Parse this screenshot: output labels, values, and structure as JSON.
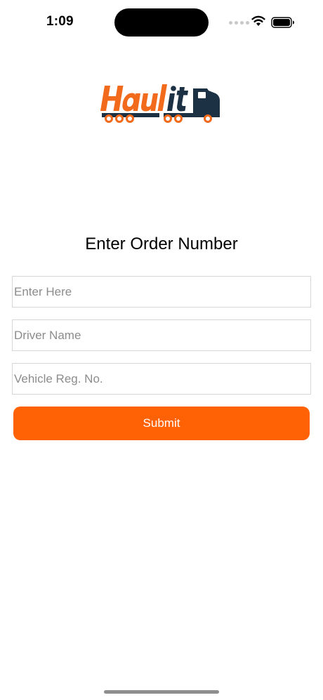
{
  "status_bar": {
    "time": "1:09"
  },
  "logo": {
    "text": "Haulit",
    "brand_color": "#f26a1b",
    "truck_color": "#1d3145"
  },
  "main": {
    "title": "Enter Order Number",
    "order_input": {
      "placeholder": "Enter Here",
      "value": ""
    },
    "driver_input": {
      "placeholder": "Driver Name",
      "value": ""
    },
    "vehicle_input": {
      "placeholder": "Vehicle Reg. No.",
      "value": ""
    },
    "submit_label": "Submit"
  },
  "colors": {
    "accent": "#ff6205",
    "field_border": "#d6d6d6",
    "placeholder": "#8c8c8c"
  }
}
